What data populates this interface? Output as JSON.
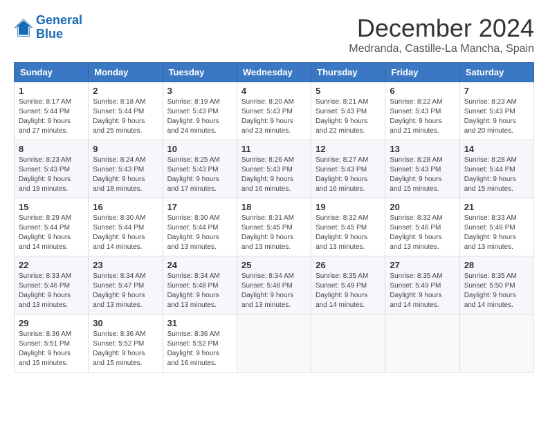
{
  "logo": {
    "line1": "General",
    "line2": "Blue"
  },
  "title": "December 2024",
  "location": "Medranda, Castille-La Mancha, Spain",
  "headers": [
    "Sunday",
    "Monday",
    "Tuesday",
    "Wednesday",
    "Thursday",
    "Friday",
    "Saturday"
  ],
  "weeks": [
    [
      {
        "day": "1",
        "sunrise": "8:17 AM",
        "sunset": "5:44 PM",
        "daylight": "9 hours and 27 minutes."
      },
      {
        "day": "2",
        "sunrise": "8:18 AM",
        "sunset": "5:44 PM",
        "daylight": "9 hours and 25 minutes."
      },
      {
        "day": "3",
        "sunrise": "8:19 AM",
        "sunset": "5:43 PM",
        "daylight": "9 hours and 24 minutes."
      },
      {
        "day": "4",
        "sunrise": "8:20 AM",
        "sunset": "5:43 PM",
        "daylight": "9 hours and 23 minutes."
      },
      {
        "day": "5",
        "sunrise": "8:21 AM",
        "sunset": "5:43 PM",
        "daylight": "9 hours and 22 minutes."
      },
      {
        "day": "6",
        "sunrise": "8:22 AM",
        "sunset": "5:43 PM",
        "daylight": "9 hours and 21 minutes."
      },
      {
        "day": "7",
        "sunrise": "8:23 AM",
        "sunset": "5:43 PM",
        "daylight": "9 hours and 20 minutes."
      }
    ],
    [
      {
        "day": "8",
        "sunrise": "8:23 AM",
        "sunset": "5:43 PM",
        "daylight": "9 hours and 19 minutes."
      },
      {
        "day": "9",
        "sunrise": "8:24 AM",
        "sunset": "5:43 PM",
        "daylight": "9 hours and 18 minutes."
      },
      {
        "day": "10",
        "sunrise": "8:25 AM",
        "sunset": "5:43 PM",
        "daylight": "9 hours and 17 minutes."
      },
      {
        "day": "11",
        "sunrise": "8:26 AM",
        "sunset": "5:43 PM",
        "daylight": "9 hours and 16 minutes."
      },
      {
        "day": "12",
        "sunrise": "8:27 AM",
        "sunset": "5:43 PM",
        "daylight": "9 hours and 16 minutes."
      },
      {
        "day": "13",
        "sunrise": "8:28 AM",
        "sunset": "5:43 PM",
        "daylight": "9 hours and 15 minutes."
      },
      {
        "day": "14",
        "sunrise": "8:28 AM",
        "sunset": "5:44 PM",
        "daylight": "9 hours and 15 minutes."
      }
    ],
    [
      {
        "day": "15",
        "sunrise": "8:29 AM",
        "sunset": "5:44 PM",
        "daylight": "9 hours and 14 minutes."
      },
      {
        "day": "16",
        "sunrise": "8:30 AM",
        "sunset": "5:44 PM",
        "daylight": "9 hours and 14 minutes."
      },
      {
        "day": "17",
        "sunrise": "8:30 AM",
        "sunset": "5:44 PM",
        "daylight": "9 hours and 13 minutes."
      },
      {
        "day": "18",
        "sunrise": "8:31 AM",
        "sunset": "5:45 PM",
        "daylight": "9 hours and 13 minutes."
      },
      {
        "day": "19",
        "sunrise": "8:32 AM",
        "sunset": "5:45 PM",
        "daylight": "9 hours and 13 minutes."
      },
      {
        "day": "20",
        "sunrise": "8:32 AM",
        "sunset": "5:46 PM",
        "daylight": "9 hours and 13 minutes."
      },
      {
        "day": "21",
        "sunrise": "8:33 AM",
        "sunset": "5:46 PM",
        "daylight": "9 hours and 13 minutes."
      }
    ],
    [
      {
        "day": "22",
        "sunrise": "8:33 AM",
        "sunset": "5:46 PM",
        "daylight": "9 hours and 13 minutes."
      },
      {
        "day": "23",
        "sunrise": "8:34 AM",
        "sunset": "5:47 PM",
        "daylight": "9 hours and 13 minutes."
      },
      {
        "day": "24",
        "sunrise": "8:34 AM",
        "sunset": "5:48 PM",
        "daylight": "9 hours and 13 minutes."
      },
      {
        "day": "25",
        "sunrise": "8:34 AM",
        "sunset": "5:48 PM",
        "daylight": "9 hours and 13 minutes."
      },
      {
        "day": "26",
        "sunrise": "8:35 AM",
        "sunset": "5:49 PM",
        "daylight": "9 hours and 14 minutes."
      },
      {
        "day": "27",
        "sunrise": "8:35 AM",
        "sunset": "5:49 PM",
        "daylight": "9 hours and 14 minutes."
      },
      {
        "day": "28",
        "sunrise": "8:35 AM",
        "sunset": "5:50 PM",
        "daylight": "9 hours and 14 minutes."
      }
    ],
    [
      {
        "day": "29",
        "sunrise": "8:36 AM",
        "sunset": "5:51 PM",
        "daylight": "9 hours and 15 minutes."
      },
      {
        "day": "30",
        "sunrise": "8:36 AM",
        "sunset": "5:52 PM",
        "daylight": "9 hours and 15 minutes."
      },
      {
        "day": "31",
        "sunrise": "8:36 AM",
        "sunset": "5:52 PM",
        "daylight": "9 hours and 16 minutes."
      },
      null,
      null,
      null,
      null
    ]
  ]
}
